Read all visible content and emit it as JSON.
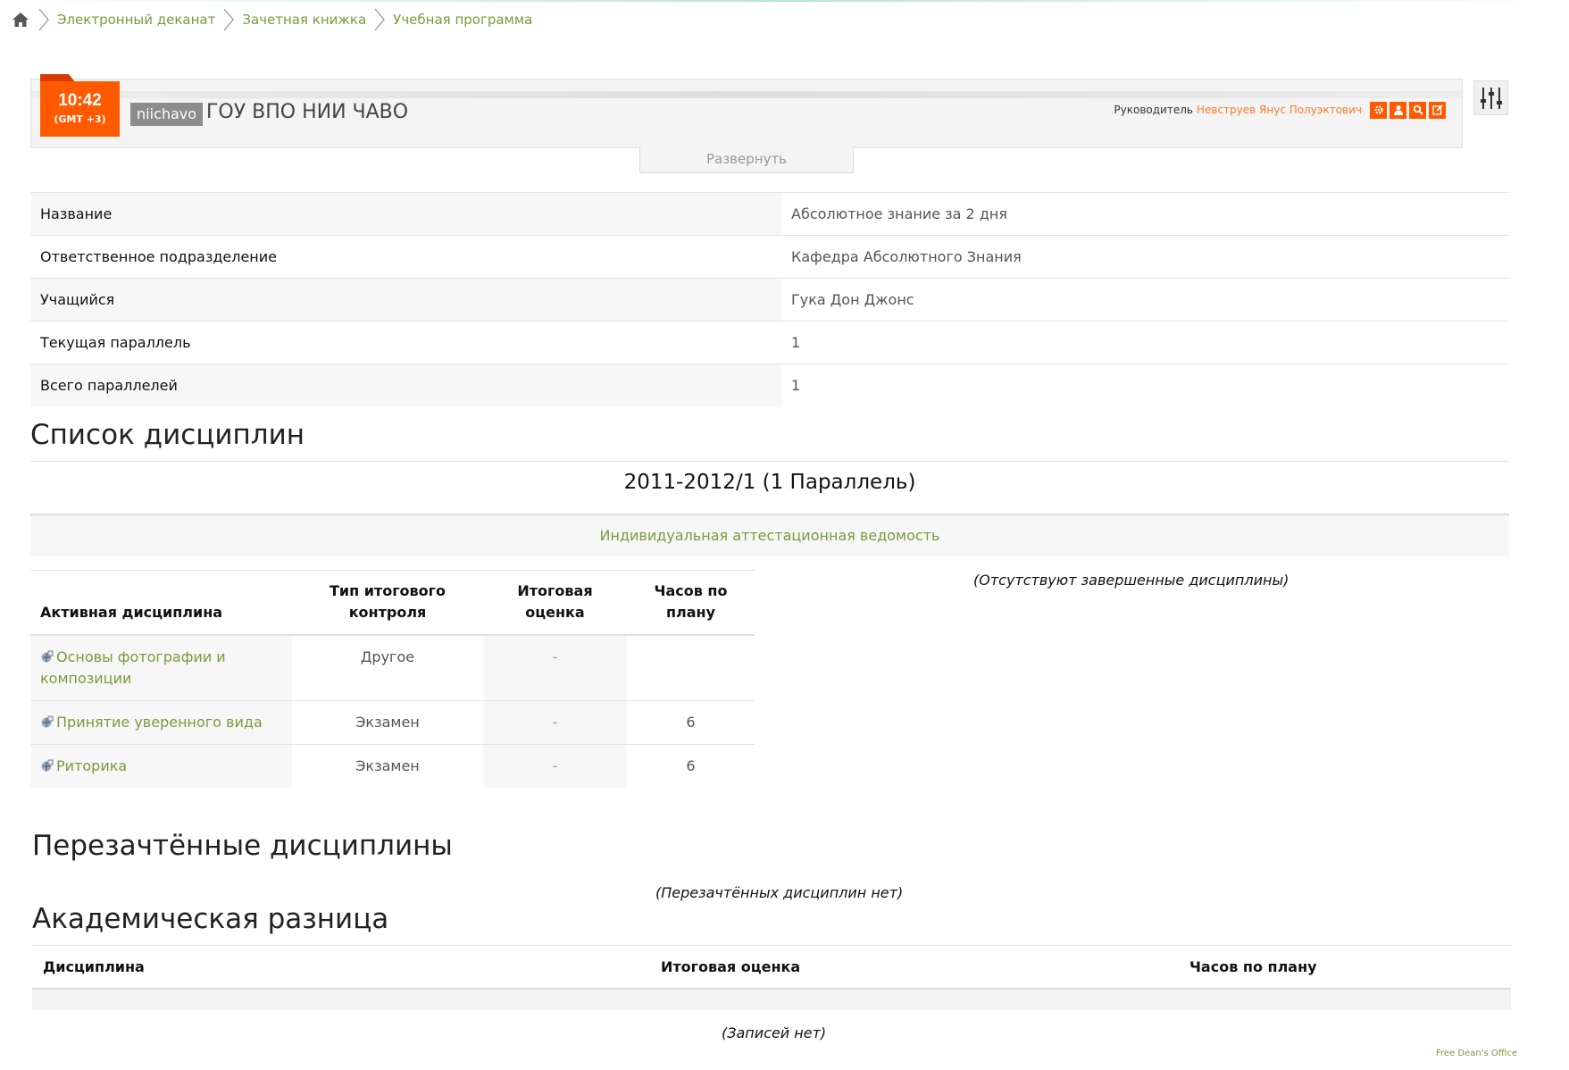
{
  "breadcrumb": {
    "home_icon": "home-icon",
    "items": [
      "Электронный деканат",
      "Зачетная книжка",
      "Учебная программа"
    ]
  },
  "header": {
    "time": "10:42",
    "timezone": "(GMT +3)",
    "org_short": "niichavo",
    "org_name": "ГОУ ВПО НИИ ЧАВО",
    "supervisor_label": "Руководитель",
    "supervisor_name": "Невструев Янус Полуэктович",
    "tools": [
      "gear-icon",
      "user-icon",
      "search-icon",
      "edit-icon"
    ],
    "expand_label": "Развернуть",
    "accent_color": "#ff5a00"
  },
  "info": {
    "rows": [
      {
        "label": "Название",
        "value": "Абсолютное знание за 2 дня"
      },
      {
        "label": "Ответственное подразделение",
        "value": "Кафедра Абсолютного Знания"
      },
      {
        "label": "Учащийся",
        "value": "Гука Дон Джонс"
      },
      {
        "label": "Текущая параллель",
        "value": "1"
      },
      {
        "label": "Всего параллелей",
        "value": "1"
      }
    ]
  },
  "disciplines": {
    "heading": "Список дисциплин",
    "period": "2011-2012/1 (1 Параллель)",
    "vedomost_link": "Индивидуальная аттестационная ведомость",
    "columns": [
      "Активная дисциплина",
      "Тип итогового контроля",
      "Итоговая оценка",
      "Часов по плану"
    ],
    "rows": [
      {
        "name": "Основы фотографии и композиции",
        "control": "Другое",
        "grade": "-",
        "hours": ""
      },
      {
        "name": "Принятие уверенного вида",
        "control": "Экзамен",
        "grade": "-",
        "hours": "6"
      },
      {
        "name": "Риторика",
        "control": "Экзамен",
        "grade": "-",
        "hours": "6"
      }
    ],
    "no_completed": "(Отсутствуют завершенные дисциплины)"
  },
  "reattested": {
    "heading": "Перезачтённые дисциплины",
    "empty": "(Перезачтённых дисциплин нет)"
  },
  "academic_difference": {
    "heading": "Академическая разница",
    "columns": [
      "Дисциплина",
      "Итоговая оценка",
      "Часов по плану"
    ],
    "empty": "(Записей нет)"
  },
  "footer": "Free Dean's Office"
}
